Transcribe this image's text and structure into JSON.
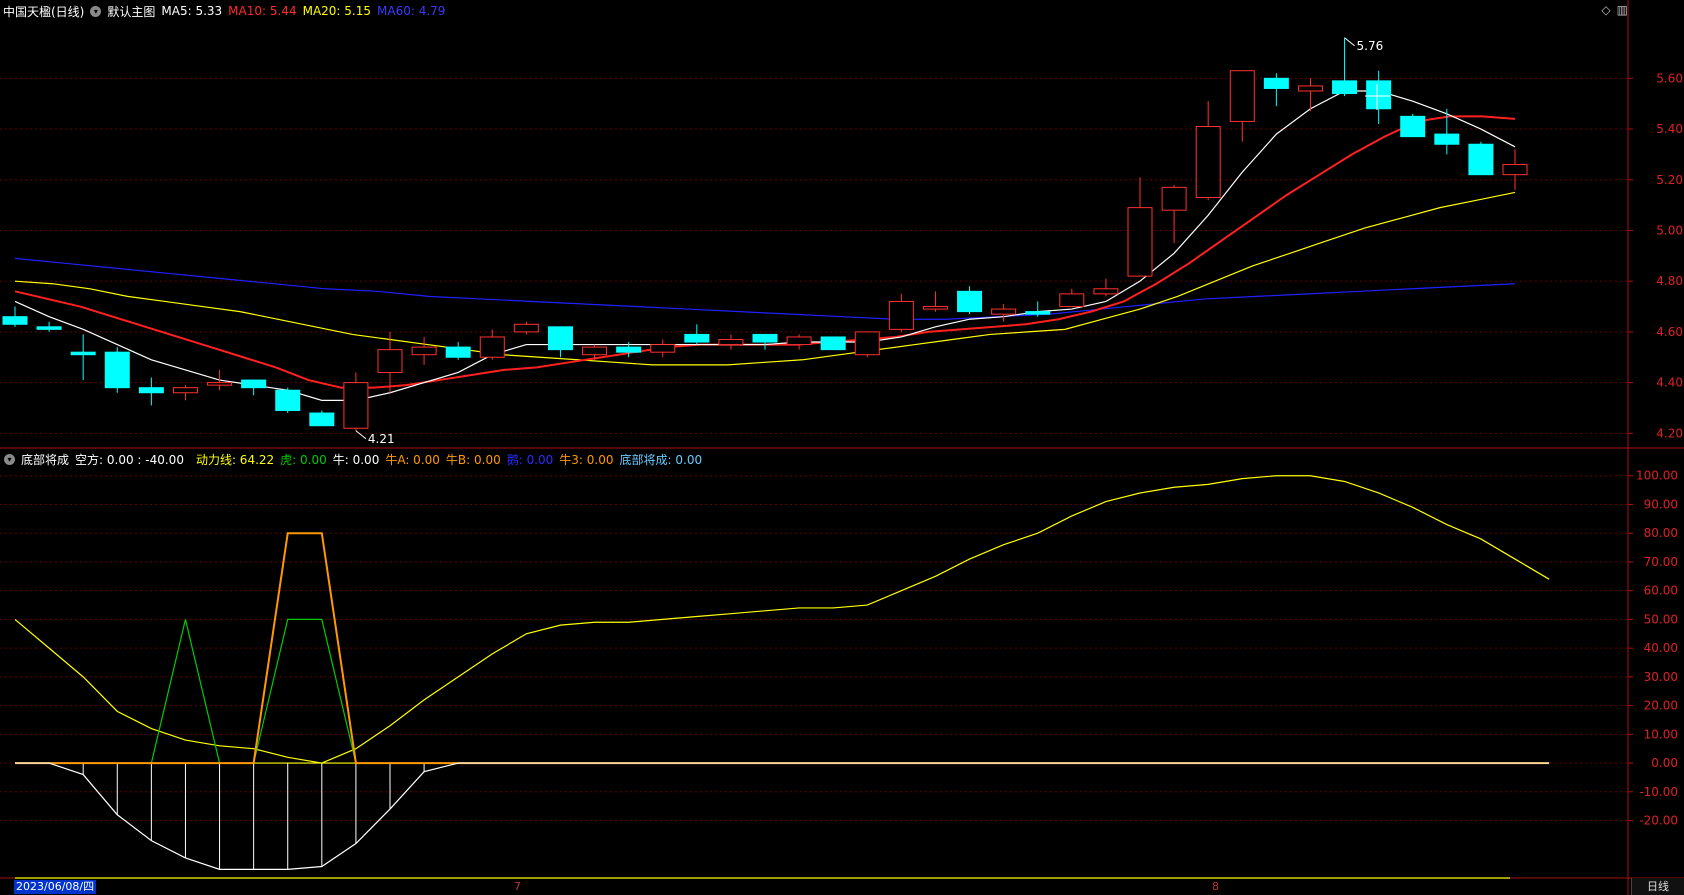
{
  "header": {
    "stock_name": "中国天楹(日线)",
    "main_chart_name": "默认主图",
    "ma_items": [
      {
        "label": "MA5: 5.33",
        "color": "#ffffff"
      },
      {
        "label": "MA10: 5.44",
        "color": "#ff2b2b"
      },
      {
        "label": "MA20: 5.15",
        "color": "#ffff00"
      },
      {
        "label": "MA60: 4.79",
        "color": "#2b2bff"
      }
    ],
    "win_icons": [
      "◇",
      "▥"
    ]
  },
  "indicator_header": {
    "name": "底部将成",
    "items": [
      {
        "label": "空方: 0.00 : -40.00",
        "color": "#ffffff"
      },
      {
        "label": "动力线: 64.22",
        "color": "#ffff00"
      },
      {
        "label": "虎: 0.00",
        "color": "#00cc00"
      },
      {
        "label": "牛: 0.00",
        "color": "#ffffff"
      },
      {
        "label": "牛A: 0.00",
        "color": "#ff9900"
      },
      {
        "label": "牛B: 0.00",
        "color": "#ff9900"
      },
      {
        "label": "鹅: 0.00",
        "color": "#0000ff"
      },
      {
        "label": "牛3: 0.00",
        "color": "#ff9900"
      },
      {
        "label": "底部将成: 0.00",
        "color": "#66ccff"
      }
    ]
  },
  "footer": {
    "date": "2023/06/08/四",
    "month_marks": [
      {
        "label": "7",
        "bar": 15
      },
      {
        "label": "8",
        "bar": 36
      }
    ],
    "period": "日线"
  },
  "colors": {
    "up": "#ff3030",
    "down": "#00ffff",
    "ma5": "#ffffff",
    "ma10": "#ff2020",
    "ma20": "#ffff00",
    "ma60": "#2020ff",
    "grid": "#660000",
    "axis": "#aa1111"
  },
  "chart_data": [
    {
      "type": "candlestick",
      "title": "中国天楹(日线)",
      "ylim": [
        4.15,
        5.83
      ],
      "yticks": [
        4.2,
        4.4,
        4.6,
        4.8,
        5.0,
        5.2,
        5.4,
        5.6
      ],
      "candles": [
        {
          "o": 4.66,
          "h": 4.7,
          "l": 4.62,
          "c": 4.63
        },
        {
          "o": 4.62,
          "h": 4.64,
          "l": 4.6,
          "c": 4.61
        },
        {
          "o": 4.52,
          "h": 4.59,
          "l": 4.41,
          "c": 4.51
        },
        {
          "o": 4.52,
          "h": 4.54,
          "l": 4.36,
          "c": 4.38
        },
        {
          "o": 4.38,
          "h": 4.42,
          "l": 4.31,
          "c": 4.36
        },
        {
          "o": 4.36,
          "h": 4.39,
          "l": 4.33,
          "c": 4.38
        },
        {
          "o": 4.39,
          "h": 4.45,
          "l": 4.37,
          "c": 4.4
        },
        {
          "o": 4.41,
          "h": 4.41,
          "l": 4.35,
          "c": 4.38
        },
        {
          "o": 4.37,
          "h": 4.38,
          "l": 4.28,
          "c": 4.29
        },
        {
          "o": 4.28,
          "h": 4.29,
          "l": 4.23,
          "c": 4.23
        },
        {
          "o": 4.22,
          "h": 4.44,
          "l": 4.21,
          "c": 4.4
        },
        {
          "o": 4.44,
          "h": 4.6,
          "l": 4.36,
          "c": 4.53
        },
        {
          "o": 4.51,
          "h": 4.58,
          "l": 4.47,
          "c": 4.54
        },
        {
          "o": 4.54,
          "h": 4.56,
          "l": 4.49,
          "c": 4.5
        },
        {
          "o": 4.5,
          "h": 4.61,
          "l": 4.49,
          "c": 4.58
        },
        {
          "o": 4.6,
          "h": 4.64,
          "l": 4.59,
          "c": 4.63
        },
        {
          "o": 4.62,
          "h": 4.62,
          "l": 4.5,
          "c": 4.53
        },
        {
          "o": 4.51,
          "h": 4.55,
          "l": 4.49,
          "c": 4.54
        },
        {
          "o": 4.54,
          "h": 4.56,
          "l": 4.5,
          "c": 4.52
        },
        {
          "o": 4.52,
          "h": 4.57,
          "l": 4.5,
          "c": 4.55
        },
        {
          "o": 4.59,
          "h": 4.63,
          "l": 4.55,
          "c": 4.56
        },
        {
          "o": 4.55,
          "h": 4.59,
          "l": 4.53,
          "c": 4.57
        },
        {
          "o": 4.59,
          "h": 4.59,
          "l": 4.53,
          "c": 4.56
        },
        {
          "o": 4.55,
          "h": 4.59,
          "l": 4.53,
          "c": 4.58
        },
        {
          "o": 4.58,
          "h": 4.58,
          "l": 4.53,
          "c": 4.53
        },
        {
          "o": 4.51,
          "h": 4.6,
          "l": 4.5,
          "c": 4.6
        },
        {
          "o": 4.61,
          "h": 4.75,
          "l": 4.6,
          "c": 4.72
        },
        {
          "o": 4.69,
          "h": 4.76,
          "l": 4.68,
          "c": 4.7
        },
        {
          "o": 4.76,
          "h": 4.78,
          "l": 4.67,
          "c": 4.68
        },
        {
          "o": 4.67,
          "h": 4.71,
          "l": 4.64,
          "c": 4.69
        },
        {
          "o": 4.68,
          "h": 4.72,
          "l": 4.66,
          "c": 4.67
        },
        {
          "o": 4.7,
          "h": 4.77,
          "l": 4.7,
          "c": 4.75
        },
        {
          "o": 4.75,
          "h": 4.81,
          "l": 4.74,
          "c": 4.77
        },
        {
          "o": 4.82,
          "h": 5.21,
          "l": 4.82,
          "c": 5.09
        },
        {
          "o": 5.08,
          "h": 5.18,
          "l": 4.95,
          "c": 5.17
        },
        {
          "o": 5.13,
          "h": 5.51,
          "l": 5.12,
          "c": 5.41
        },
        {
          "o": 5.43,
          "h": 5.63,
          "l": 5.35,
          "c": 5.63
        },
        {
          "o": 5.6,
          "h": 5.62,
          "l": 5.49,
          "c": 5.56
        },
        {
          "o": 5.55,
          "h": 5.6,
          "l": 5.47,
          "c": 5.57
        },
        {
          "o": 5.59,
          "h": 5.76,
          "l": 5.53,
          "c": 5.54
        },
        {
          "o": 5.59,
          "h": 5.63,
          "l": 5.42,
          "c": 5.48
        },
        {
          "o": 5.45,
          "h": 5.46,
          "l": 5.37,
          "c": 5.37
        },
        {
          "o": 5.38,
          "h": 5.48,
          "l": 5.3,
          "c": 5.34
        },
        {
          "o": 5.34,
          "h": 5.35,
          "l": 5.22,
          "c": 5.22
        },
        {
          "o": 5.22,
          "h": 5.32,
          "l": 5.16,
          "c": 5.26
        }
      ],
      "ma5": [
        4.72,
        4.66,
        4.61,
        4.55,
        4.49,
        4.45,
        4.41,
        4.39,
        4.37,
        4.33,
        4.33,
        4.36,
        4.4,
        4.44,
        4.51,
        4.55,
        4.55,
        4.55,
        4.55,
        4.55,
        4.55,
        4.55,
        4.55,
        4.56,
        4.56,
        4.56,
        4.58,
        4.62,
        4.65,
        4.66,
        4.68,
        4.69,
        4.72,
        4.8,
        4.91,
        5.06,
        5.23,
        5.38,
        5.48,
        5.55,
        5.55,
        5.51,
        5.46,
        5.4,
        5.33
      ],
      "ma10": [
        4.76,
        4.73,
        4.7,
        4.66,
        4.62,
        4.58,
        4.54,
        4.5,
        4.46,
        4.41,
        4.38,
        4.38,
        4.39,
        4.41,
        4.43,
        4.45,
        4.46,
        4.48,
        4.5,
        4.52,
        4.54,
        4.55,
        4.55,
        4.55,
        4.55,
        4.56,
        4.57,
        4.58,
        4.6,
        4.61,
        4.62,
        4.63,
        4.65,
        4.68,
        4.72,
        4.79,
        4.87,
        4.96,
        5.05,
        5.14,
        5.22,
        5.3,
        5.37,
        5.43,
        5.45,
        5.45,
        5.44
      ],
      "ma20": [
        4.8,
        4.79,
        4.77,
        4.74,
        4.72,
        4.7,
        4.68,
        4.65,
        4.62,
        4.59,
        4.57,
        4.55,
        4.53,
        4.51,
        4.5,
        4.49,
        4.48,
        4.47,
        4.47,
        4.47,
        4.48,
        4.49,
        4.51,
        4.53,
        4.55,
        4.57,
        4.59,
        4.6,
        4.61,
        4.65,
        4.69,
        4.74,
        4.8,
        4.86,
        4.91,
        4.96,
        5.01,
        5.05,
        5.09,
        5.12,
        5.15
      ],
      "ma60": [
        4.89,
        4.87,
        4.85,
        4.83,
        4.81,
        4.79,
        4.77,
        4.76,
        4.74,
        4.73,
        4.72,
        4.71,
        4.7,
        4.69,
        4.68,
        4.67,
        4.66,
        4.65,
        4.65,
        4.66,
        4.67,
        4.69,
        4.71,
        4.73,
        4.74,
        4.75,
        4.76,
        4.77,
        4.78,
        4.79
      ],
      "annotations": [
        {
          "label": "5.76",
          "bar": 39,
          "price": 5.76
        },
        {
          "label": "4.21",
          "bar": 10,
          "price": 4.21
        }
      ]
    },
    {
      "type": "line",
      "title": "底部将成",
      "ylim": [
        -40,
        102
      ],
      "yticks": [
        100,
        90,
        80,
        70,
        60,
        50,
        40,
        30,
        20,
        10,
        0,
        -10,
        -20
      ],
      "series": [
        {
          "name": "动力线",
          "color": "#ffff00",
          "values": [
            50,
            40,
            30,
            18,
            12,
            8,
            6,
            5,
            2,
            0,
            5,
            13,
            22,
            30,
            38,
            45,
            48,
            49,
            49,
            50,
            51,
            52,
            53,
            54,
            54,
            55,
            60,
            65,
            71,
            76,
            80,
            86,
            91,
            94,
            96,
            97,
            99,
            100,
            100,
            98,
            94,
            89,
            83,
            78,
            71,
            64
          ]
        },
        {
          "name": "虎",
          "color": "#00cc00",
          "values": [
            0,
            0,
            0,
            0,
            0,
            50,
            0,
            0,
            50,
            50,
            0,
            0,
            0,
            0,
            0,
            0,
            0,
            0,
            0,
            0,
            0,
            0,
            0,
            0,
            0,
            0,
            0,
            0,
            0,
            0,
            0,
            0,
            0,
            0,
            0,
            0,
            0,
            0,
            0,
            0,
            0,
            0,
            0,
            0,
            0,
            0
          ]
        },
        {
          "name": "牛A",
          "color": "#ff9900",
          "values": [
            0,
            0,
            0,
            0,
            0,
            0,
            0,
            0,
            80,
            80,
            0,
            0,
            0,
            0,
            0,
            0,
            0,
            0,
            0,
            0,
            0,
            0,
            0,
            0,
            0,
            0,
            0,
            0,
            0,
            0,
            0,
            0,
            0,
            0,
            0,
            0,
            0,
            0,
            0,
            0,
            0,
            0,
            0,
            0,
            0,
            0
          ]
        },
        {
          "name": "空方",
          "color": "#ffffff",
          "values": [
            0,
            0,
            -4,
            -18,
            -27,
            -33,
            -37,
            -37,
            -37,
            -36,
            -28,
            -16,
            -3,
            0,
            0,
            0,
            0,
            0,
            0,
            0,
            0,
            0,
            0,
            0,
            0,
            0,
            0,
            0,
            0,
            0,
            0,
            0,
            0,
            0,
            0,
            0,
            0,
            0,
            0,
            0,
            0,
            0,
            0,
            0,
            0,
            0
          ]
        }
      ],
      "reference_lines": [
        0,
        -40
      ]
    }
  ]
}
